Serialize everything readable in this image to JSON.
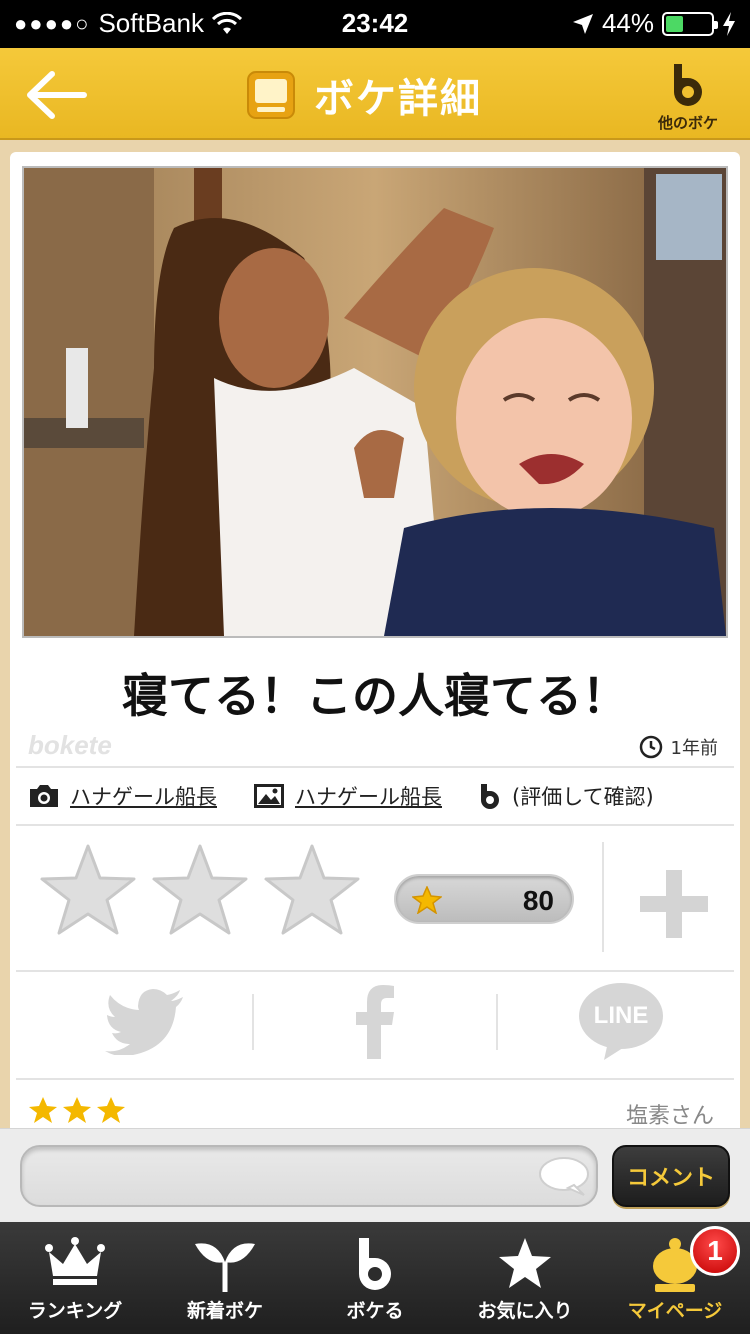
{
  "status_bar": {
    "signal": "●●●●○",
    "carrier": "SoftBank",
    "time": "23:42",
    "battery_percent": "44%",
    "battery_level": 0.44
  },
  "nav": {
    "title": "ボケ詳細",
    "other_boke_label": "他のボケ",
    "accent": "#f5c93a"
  },
  "post": {
    "caption": "寝てる！この人寝てる！",
    "watermark": "bokete",
    "posted_ago": "1年前",
    "photo_by": "ハナゲール船長",
    "boke_by": "ハナゲール船長",
    "rating_note": "(評価して確認)"
  },
  "rating": {
    "score": "80",
    "star_count": 3
  },
  "share": {
    "twitter": "twitter-icon",
    "facebook": "facebook-icon",
    "line_label": "LINE"
  },
  "comment_preview": {
    "stars": 3,
    "author": "塩素さん"
  },
  "comment_bar": {
    "placeholder": "",
    "button_label": "コメント"
  },
  "tabs": [
    {
      "label": "ランキング",
      "icon": "crown-icon"
    },
    {
      "label": "新着ボケ",
      "icon": "sprout-icon"
    },
    {
      "label": "ボケる",
      "icon": "bokete-b-icon"
    },
    {
      "label": "お気に入り",
      "icon": "star-icon"
    },
    {
      "label": "マイページ",
      "icon": "mypage-icon",
      "badge": "1"
    }
  ]
}
